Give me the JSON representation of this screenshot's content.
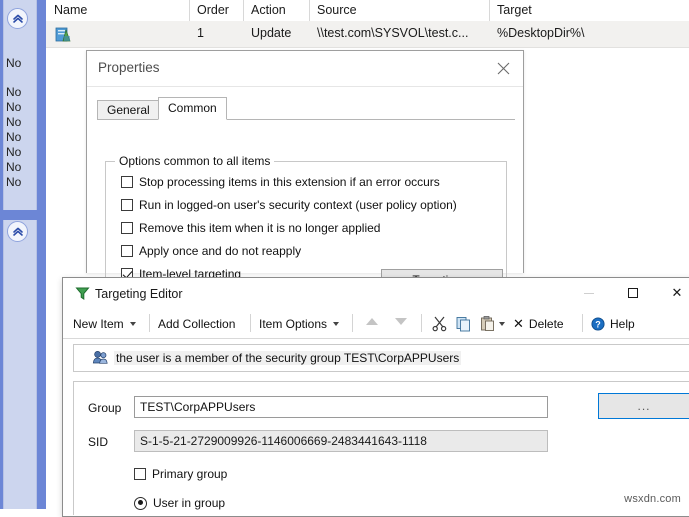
{
  "list_view": {
    "columns": [
      "Name",
      "Order",
      "Action",
      "Source",
      "Target"
    ],
    "row": {
      "name": "",
      "order": "1",
      "action": "Update",
      "source": "\\\\test.com\\SYSVOL\\test.c...",
      "target": "%DesktopDir%\\",
      "icon": "shortcut-file-icon"
    },
    "nav": {
      "collapse_icon": "chevron-up-icon",
      "expand_icon": "chevron-up-icon",
      "values": [
        "No",
        "No",
        "No",
        "No",
        "No",
        "No",
        "No",
        "No"
      ]
    }
  },
  "properties_dialog": {
    "title": "Properties",
    "close_icon": "close-icon",
    "tabs": [
      {
        "label": "General",
        "selected": false
      },
      {
        "label": "Common",
        "selected": true
      }
    ],
    "group_label": "Options common to all items",
    "options": [
      {
        "label": "Stop processing items in this extension if an error occurs",
        "checked": false
      },
      {
        "label": "Run in logged-on user's security context (user policy option)",
        "checked": false
      },
      {
        "label": "Remove this item when it is no longer applied",
        "checked": false
      },
      {
        "label": "Apply once and do not reapply",
        "checked": false
      },
      {
        "label": "Item-level targeting",
        "checked": true
      }
    ],
    "targeting_button": "Targeting..."
  },
  "targeting_editor": {
    "title": "Targeting Editor",
    "title_icon": "filter-funnel-icon",
    "window_controls": {
      "minimize_icon": "minimize-icon",
      "maximize_icon": "maximize-icon",
      "close_icon": "close-icon"
    },
    "toolbar": {
      "new_item": "New Item",
      "add_collection": "Add Collection",
      "item_options": "Item Options",
      "move_up_icon": "arrow-up-icon",
      "move_down_icon": "arrow-down-icon",
      "cut_icon": "scissors-icon",
      "copy_icon": "copy-icon",
      "paste_icon": "paste-icon",
      "delete": "Delete",
      "delete_icon": "x-icon",
      "help": "Help",
      "help_icon": "question-circle-icon"
    },
    "condition": {
      "icon": "user-group-icon",
      "text": "the user is a member of the security group TEST\\CorpAPPUsers"
    },
    "fields": {
      "group_label": "Group",
      "group_value": "TEST\\CorpAPPUsers",
      "browse_button": "...",
      "sid_label": "SID",
      "sid_value": "S-1-5-21-2729009926-1146006669-2483441643-1118"
    },
    "options": [
      {
        "type": "checkbox",
        "label": "Primary group",
        "checked": false
      },
      {
        "type": "radio",
        "label": "User in group",
        "selected": true
      }
    ]
  },
  "watermark": "wsxdn.com",
  "colors": {
    "nav_blue": "#6c86d6",
    "nav_panel": "#ccd5ee",
    "row_highlight": "#f2f1ef",
    "focus_blue": "#0078d7"
  }
}
